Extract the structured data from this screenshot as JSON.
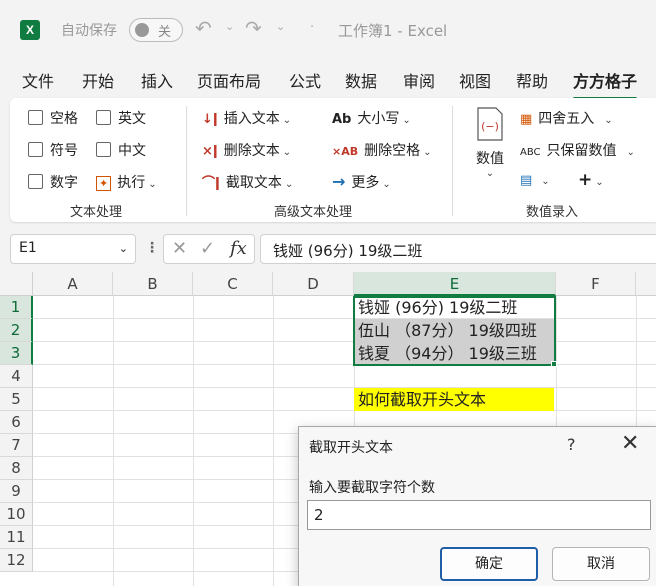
{
  "titlebar": {
    "app_icon": "excel-logo-icon",
    "app_logo_letter": "X",
    "autosave_label": "自动保存",
    "autosave_state": "关",
    "separator": "·",
    "doc_title": "工作簿1  -  Excel"
  },
  "menu": {
    "tabs": [
      "文件",
      "开始",
      "插入",
      "页面布局",
      "公式",
      "数据",
      "审阅",
      "视图",
      "帮助",
      "方方格子"
    ],
    "active": "方方格子"
  },
  "ribbon": {
    "text_group": {
      "label": "文本处理",
      "checkboxes": [
        "空格",
        "英文",
        "符号",
        "中文",
        "数字"
      ],
      "execute_label": "执行"
    },
    "advanced_group": {
      "label": "高级文本处理",
      "insert_text": "插入文本",
      "delete_text": "删除文本",
      "extract_text": "截取文本",
      "case_label": "大小写",
      "case_icon_text": "Ab",
      "delete_space": "删除空格",
      "delete_space_icon_text": "×AB",
      "more": "更多"
    },
    "number_group": {
      "label": "数值录入",
      "number_button": "数值",
      "round": "四舍五入",
      "keep_numbers": "只保留数值",
      "keep_numbers_icon_text": "ABC",
      "plus_glyph": "+"
    }
  },
  "formula_bar": {
    "name_box": "E1",
    "fx": "fx",
    "content": "钱娅 (96分) 19级二班"
  },
  "sheet": {
    "columns": [
      "A",
      "B",
      "C",
      "D",
      "E",
      "F"
    ],
    "rows": [
      "1",
      "2",
      "3",
      "4",
      "5",
      "6",
      "7",
      "8",
      "9",
      "10",
      "11",
      "12"
    ],
    "selected_column": "E",
    "cells": {
      "E1": "钱娅 (96分) 19级二班",
      "E2": "伍山 （87分） 19级四班",
      "E3": "钱夏 （94分） 19级三班",
      "E5": "如何截取开头文本"
    },
    "highlight_color": "#ffff00",
    "selection_color": "#107c41"
  },
  "dialog": {
    "title": "截取开头文本",
    "help": "?",
    "prompt": "输入要截取字符个数",
    "input_value": "2",
    "ok_label": "确定",
    "cancel_label": "取消"
  }
}
